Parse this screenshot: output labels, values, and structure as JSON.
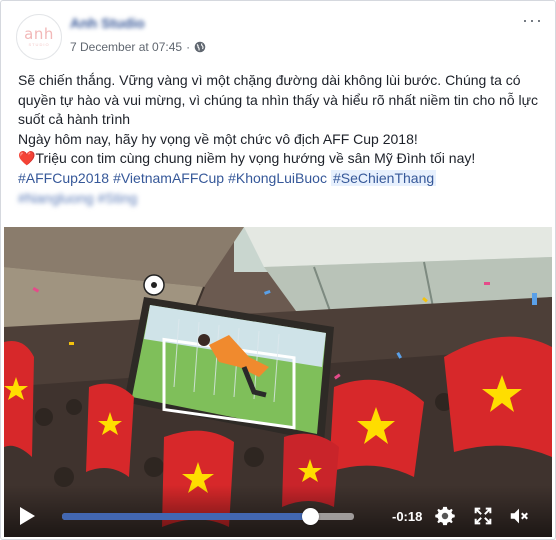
{
  "post": {
    "page_name": "Anh Studio",
    "timestamp": "7 December at 07:45",
    "separator": "·",
    "avatar_logo": "anh",
    "avatar_logo_sub": "STUDIO",
    "more_icon": "more-horizontal-icon",
    "privacy_icon": "globe-icon",
    "lines": [
      "Sẽ chiến thắng. Vững vàng vì một chặng đường dài không lùi bước. Chúng ta có quyền tự hào và vui mừng, vì chúng ta nhìn thấy và hiểu rõ nhất niềm tin cho nỗ lực suốt cả hành trình",
      "Ngày hôm nay, hãy hy vọng về một chức vô địch AFF Cup 2018!",
      "Triệu con tim cùng chung niềm hy vọng hướng về sân Mỹ Đình tối nay!"
    ],
    "heart_icon": "❤️",
    "hashtags": [
      "#AFFCup2018",
      "#VietnamAFFCup",
      "#KhongLuiBuoc",
      "#SeChienThang"
    ],
    "hashtags_blurred": [
      "#Nangluong",
      "#Sting"
    ]
  },
  "video": {
    "time_remaining": "-0:18",
    "progress": 0.85,
    "colors": {
      "accent": "#4267b2",
      "flag_red": "#d7282a",
      "star_yellow": "#ffdd00"
    },
    "icons": [
      "play-icon",
      "settings-gear-icon",
      "fullscreen-icon",
      "volume-muted-icon"
    ]
  }
}
